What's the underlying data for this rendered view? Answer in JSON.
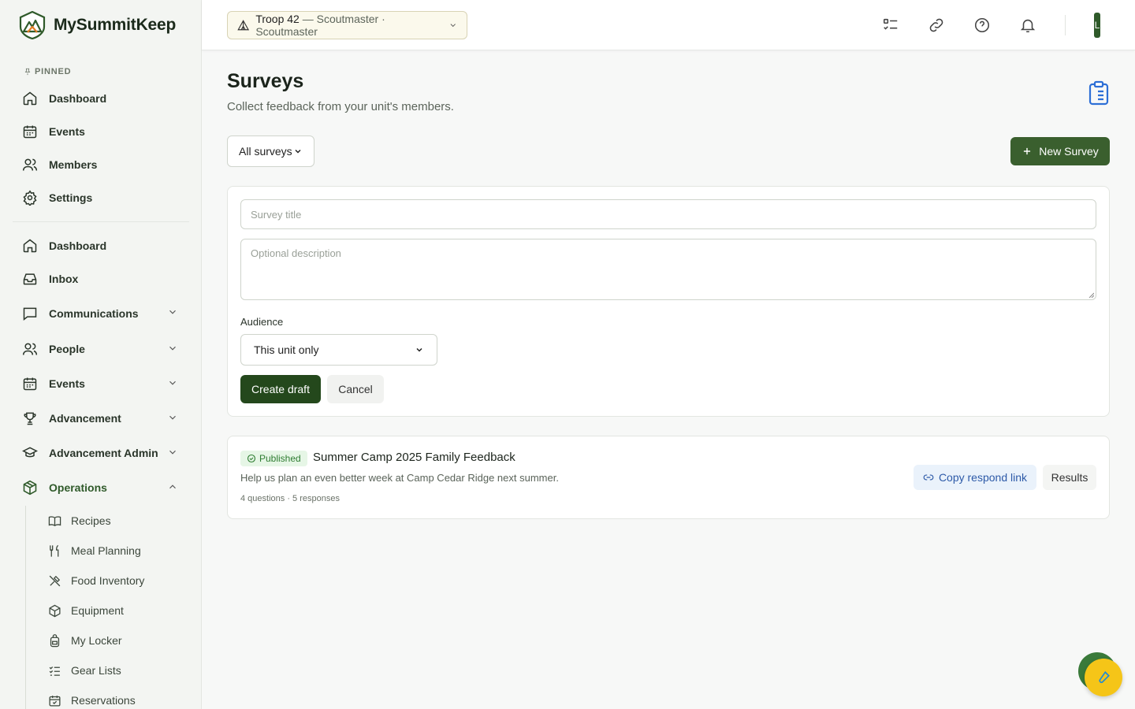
{
  "brand": {
    "name": "MySummitKeep"
  },
  "sidebar": {
    "pinned_label": "PINNED",
    "pinned": [
      {
        "label": "Dashboard",
        "icon": "home-icon"
      },
      {
        "label": "Events",
        "icon": "calendar-icon"
      },
      {
        "label": "Members",
        "icon": "users-icon"
      },
      {
        "label": "Settings",
        "icon": "gear-icon"
      }
    ],
    "items": [
      {
        "label": "Dashboard",
        "icon": "home-icon"
      },
      {
        "label": "Inbox",
        "icon": "inbox-icon"
      },
      {
        "label": "Communications",
        "icon": "message-icon"
      },
      {
        "label": "People",
        "icon": "users-icon"
      },
      {
        "label": "Events",
        "icon": "calendar-icon"
      },
      {
        "label": "Advancement",
        "icon": "trophy-icon"
      },
      {
        "label": "Advancement Admin",
        "icon": "graduation-cap-icon"
      },
      {
        "label": "Operations",
        "icon": "package-icon"
      }
    ],
    "operations_sub": [
      {
        "label": "Recipes",
        "icon": "book-icon"
      },
      {
        "label": "Meal Planning",
        "icon": "utensils-icon"
      },
      {
        "label": "Food Inventory",
        "icon": "utensils-crossed-icon"
      },
      {
        "label": "Equipment",
        "icon": "box-icon"
      },
      {
        "label": "My Locker",
        "icon": "backpack-icon"
      },
      {
        "label": "Gear Lists",
        "icon": "checklist-icon"
      },
      {
        "label": "Reservations",
        "icon": "calendar-check-icon"
      }
    ]
  },
  "topbar": {
    "unit_name": "Troop 42",
    "unit_role": " — Scoutmaster · Scoutmaster",
    "avatar_initial": "L"
  },
  "page": {
    "title": "Surveys",
    "subtitle": "Collect feedback from your unit's members.",
    "filter_value": "All surveys",
    "new_survey_label": "New Survey"
  },
  "form": {
    "title_placeholder": "Survey title",
    "description_placeholder": "Optional description",
    "audience_label": "Audience",
    "audience_value": "This unit only",
    "create_label": "Create draft",
    "cancel_label": "Cancel"
  },
  "surveys": [
    {
      "status": "Published",
      "title": "Summer Camp 2025 Family Feedback",
      "description": "Help us plan an even better week at Camp Cedar Ridge next summer.",
      "meta": "4 questions · 5 responses",
      "copy_label": "Copy respond link",
      "results_label": "Results"
    }
  ],
  "colors": {
    "brand_green": "#3a5f2e",
    "dark_green": "#24481c",
    "published_green": "#2f7d32",
    "link_blue": "#2d5aa8",
    "fab_yellow": "#f5c518"
  }
}
